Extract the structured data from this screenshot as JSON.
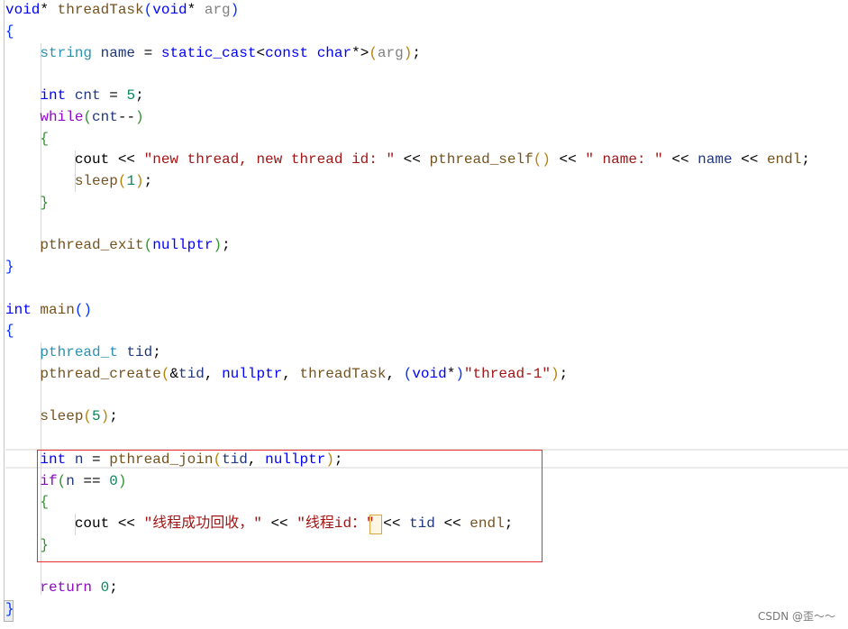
{
  "editor": {
    "lines": [
      [
        [
          "k",
          "void"
        ],
        [
          "d",
          "* "
        ],
        [
          "f",
          "threadTask"
        ],
        [
          "b1",
          "("
        ],
        [
          "k",
          "void"
        ],
        [
          "d",
          "* "
        ],
        [
          "p",
          "arg"
        ],
        [
          "b1",
          ")"
        ]
      ],
      [
        [
          "b1",
          "{"
        ]
      ],
      [
        [
          "d",
          "    "
        ],
        [
          "t",
          "string"
        ],
        [
          "d",
          " "
        ],
        [
          "v",
          "name"
        ],
        [
          "d",
          " = "
        ],
        [
          "k",
          "static_cast"
        ],
        [
          "d",
          "<"
        ],
        [
          "k",
          "const"
        ],
        [
          "d",
          " "
        ],
        [
          "k",
          "char"
        ],
        [
          "d",
          "*>"
        ],
        [
          "b3",
          "("
        ],
        [
          "p",
          "arg"
        ],
        [
          "b3",
          ")"
        ],
        [
          "d",
          ";"
        ]
      ],
      [],
      [
        [
          "d",
          "    "
        ],
        [
          "k",
          "int"
        ],
        [
          "d",
          " "
        ],
        [
          "v",
          "cnt"
        ],
        [
          "d",
          " = "
        ],
        [
          "n",
          "5"
        ],
        [
          "d",
          ";"
        ]
      ],
      [
        [
          "d",
          "    "
        ],
        [
          "c",
          "while"
        ],
        [
          "b2",
          "("
        ],
        [
          "v",
          "cnt"
        ],
        [
          "d",
          "--"
        ],
        [
          "b2",
          ")"
        ]
      ],
      [
        [
          "d",
          "    "
        ],
        [
          "b2",
          "{"
        ]
      ],
      [
        [
          "d",
          "        "
        ],
        [
          "d",
          "cout"
        ],
        [
          "d",
          " << "
        ],
        [
          "s",
          "\"new thread, new thread id: \""
        ],
        [
          "d",
          " << "
        ],
        [
          "f",
          "pthread_self"
        ],
        [
          "b3",
          "()"
        ],
        [
          "d",
          " << "
        ],
        [
          "s",
          "\" name: \""
        ],
        [
          "d",
          " << "
        ],
        [
          "v",
          "name"
        ],
        [
          "d",
          " << "
        ],
        [
          "f",
          "endl"
        ],
        [
          "d",
          ";"
        ]
      ],
      [
        [
          "d",
          "        "
        ],
        [
          "f",
          "sleep"
        ],
        [
          "b3",
          "("
        ],
        [
          "n",
          "1"
        ],
        [
          "b3",
          ")"
        ],
        [
          "d",
          ";"
        ]
      ],
      [
        [
          "d",
          "    "
        ],
        [
          "b2",
          "}"
        ]
      ],
      [],
      [
        [
          "d",
          "    "
        ],
        [
          "f",
          "pthread_exit"
        ],
        [
          "b2",
          "("
        ],
        [
          "k",
          "nullptr"
        ],
        [
          "b2",
          ")"
        ],
        [
          "d",
          ";"
        ]
      ],
      [
        [
          "b1",
          "}"
        ]
      ],
      [],
      [
        [
          "k",
          "int"
        ],
        [
          "d",
          " "
        ],
        [
          "f",
          "main"
        ],
        [
          "b1",
          "()"
        ]
      ],
      [
        [
          "b1",
          "{"
        ]
      ],
      [
        [
          "d",
          "    "
        ],
        [
          "t",
          "pthread_t"
        ],
        [
          "d",
          " "
        ],
        [
          "v",
          "tid"
        ],
        [
          "d",
          ";"
        ]
      ],
      [
        [
          "d",
          "    "
        ],
        [
          "f",
          "pthread_create"
        ],
        [
          "b3",
          "("
        ],
        [
          "d",
          "&"
        ],
        [
          "v",
          "tid"
        ],
        [
          "d",
          ", "
        ],
        [
          "k",
          "nullptr"
        ],
        [
          "d",
          ", "
        ],
        [
          "f",
          "threadTask"
        ],
        [
          "d",
          ", "
        ],
        [
          "b1",
          "("
        ],
        [
          "k",
          "void"
        ],
        [
          "d",
          "*"
        ],
        [
          "b1",
          ")"
        ],
        [
          "s",
          "\"thread-1\""
        ],
        [
          "b3",
          ")"
        ],
        [
          "d",
          ";"
        ]
      ],
      [],
      [
        [
          "d",
          "    "
        ],
        [
          "f",
          "sleep"
        ],
        [
          "b3",
          "("
        ],
        [
          "n",
          "5"
        ],
        [
          "b3",
          ")"
        ],
        [
          "d",
          ";"
        ]
      ],
      [],
      [
        [
          "d",
          "    "
        ],
        [
          "k",
          "int"
        ],
        [
          "d",
          " "
        ],
        [
          "v",
          "n"
        ],
        [
          "d",
          " = "
        ],
        [
          "f",
          "pthread_join"
        ],
        [
          "b3",
          "("
        ],
        [
          "v",
          "tid"
        ],
        [
          "d",
          ", "
        ],
        [
          "k",
          "nullptr"
        ],
        [
          "b3",
          ")"
        ],
        [
          "d",
          ";"
        ]
      ],
      [
        [
          "d",
          "    "
        ],
        [
          "c",
          "if"
        ],
        [
          "b2",
          "("
        ],
        [
          "v",
          "n"
        ],
        [
          "d",
          " == "
        ],
        [
          "n",
          "0"
        ],
        [
          "b2",
          ")"
        ]
      ],
      [
        [
          "d",
          "    "
        ],
        [
          "b2",
          "{"
        ]
      ],
      [
        [
          "d",
          "        "
        ],
        [
          "d",
          "cout"
        ],
        [
          "d",
          " << "
        ],
        [
          "s",
          "\"线程成功回收，\""
        ],
        [
          "d",
          " << "
        ],
        [
          "s",
          "\"线程id：\""
        ],
        [
          "d",
          " << "
        ],
        [
          "v",
          "tid"
        ],
        [
          "d",
          " << "
        ],
        [
          "f",
          "endl"
        ],
        [
          "d",
          ";"
        ]
      ],
      [
        [
          "d",
          "    "
        ],
        [
          "b2",
          "}"
        ]
      ],
      [],
      [
        [
          "d",
          "    "
        ],
        [
          "c",
          "return"
        ],
        [
          "d",
          " "
        ],
        [
          "n",
          "0"
        ],
        [
          "d",
          ";"
        ]
      ],
      [
        [
          "b1",
          "}"
        ]
      ]
    ]
  },
  "watermark": "CSDN @歪～～"
}
